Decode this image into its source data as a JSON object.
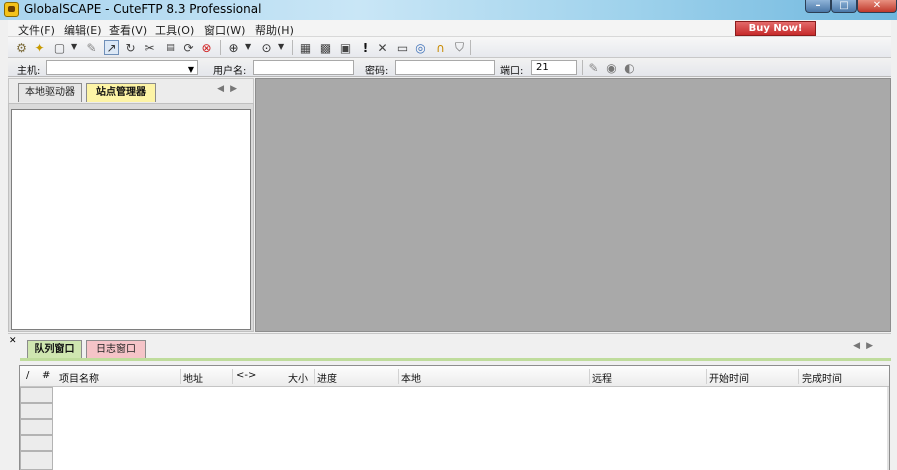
{
  "window": {
    "title": "GlobalSCAPE - CuteFTP 8.3 Professional"
  },
  "menu": {
    "items": [
      "文件(F)",
      "编辑(E)",
      "查看(V)",
      "工具(O)",
      "窗口(W)",
      "帮助(H)"
    ],
    "buy_label": "Buy Now!"
  },
  "toolbar": {
    "icons": [
      "connect-wizard-icon",
      "quick-connect-icon",
      "new-site-icon",
      "dropdown-icon",
      "edit-icon",
      "connect-icon",
      "reconnect-icon",
      "disconnect-icon",
      "print-icon",
      "refresh-icon",
      "stop-icon",
      "download-icon",
      "download-drop-icon",
      "upload-icon",
      "upload-drop-icon",
      "properties-icon",
      "compress-icon",
      "folder-icon",
      "alert-icon",
      "delete-icon",
      "view-icon",
      "settings-icon",
      "help-icon",
      "shield-icon"
    ]
  },
  "connection": {
    "host_label": "主机:",
    "host_value": "",
    "user_label": "用户名:",
    "user_value": "",
    "password_label": "密码:",
    "password_value": "",
    "port_label": "端口:",
    "port_value": "21"
  },
  "left_tabs": {
    "local": "本地驱动器",
    "site": "站点管理器"
  },
  "bottom_tabs": {
    "queue": "队列窗口",
    "log": "日志窗口"
  },
  "queue": {
    "columns": [
      "/",
      "#",
      "项目名称",
      "地址",
      "<->",
      "大小",
      "进度",
      "本地",
      "远程",
      "开始时间",
      "完成时间"
    ]
  }
}
